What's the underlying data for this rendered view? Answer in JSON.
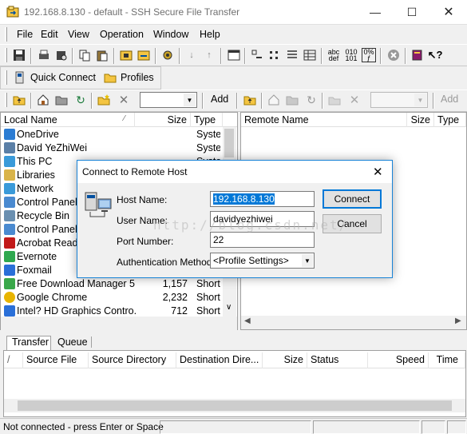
{
  "window": {
    "title": "192.168.8.130 - default - SSH Secure File Transfer"
  },
  "menu": [
    "File",
    "Edit",
    "View",
    "Operation",
    "Window",
    "Help"
  ],
  "toolbar": {
    "quick_connect": "Quick Connect",
    "profiles": "Profiles"
  },
  "local_toolbar": {
    "add": "Add"
  },
  "remote_toolbar": {
    "add": "Add"
  },
  "local_pane": {
    "columns": [
      "Local Name",
      "Size",
      "Type"
    ],
    "rows": [
      {
        "name": "OneDrive",
        "size": "",
        "type": "System"
      },
      {
        "name": "David YeZhiWei",
        "size": "",
        "type": "System"
      },
      {
        "name": "This PC",
        "size": "",
        "type": "System"
      },
      {
        "name": "Libraries",
        "size": "",
        "type": ""
      },
      {
        "name": "Network",
        "size": "",
        "type": ""
      },
      {
        "name": "Control Panel",
        "size": "",
        "type": ""
      },
      {
        "name": "Recycle Bin",
        "size": "",
        "type": ""
      },
      {
        "name": "Control Panel",
        "size": "",
        "type": ""
      },
      {
        "name": "Acrobat Reade",
        "size": "",
        "type": ""
      },
      {
        "name": "Evernote",
        "size": "",
        "type": ""
      },
      {
        "name": "Foxmail",
        "size": "",
        "type": ""
      },
      {
        "name": "Free Download Manager 5",
        "size": "1,157",
        "type": "Shortc"
      },
      {
        "name": "Google Chrome",
        "size": "2,232",
        "type": "Shortc"
      },
      {
        "name": "Intel? HD Graphics Contro...",
        "size": "712",
        "type": "Shortc"
      }
    ]
  },
  "remote_pane": {
    "columns": [
      "Remote Name",
      "Size",
      "Type"
    ]
  },
  "transfer": {
    "tabs": [
      "Transfer",
      "Queue"
    ],
    "columns": [
      "/",
      "Source File",
      "Source Directory",
      "Destination Dire...",
      "Size",
      "Status",
      "Speed",
      "Time"
    ]
  },
  "status_bar": {
    "text": "Not connected - press Enter or Space"
  },
  "dialog": {
    "title": "Connect to Remote Host",
    "host_label": "Host Name:",
    "host_value": "192.168.8.130",
    "user_label": "User Name:",
    "user_value": "davidyezhiwei",
    "port_label": "Port Number:",
    "port_value": "22",
    "auth_label": "Authentication Method:",
    "auth_value": "<Profile Settings>",
    "connect": "Connect",
    "cancel": "Cancel"
  },
  "watermark": "http://blog.csdn.net/"
}
